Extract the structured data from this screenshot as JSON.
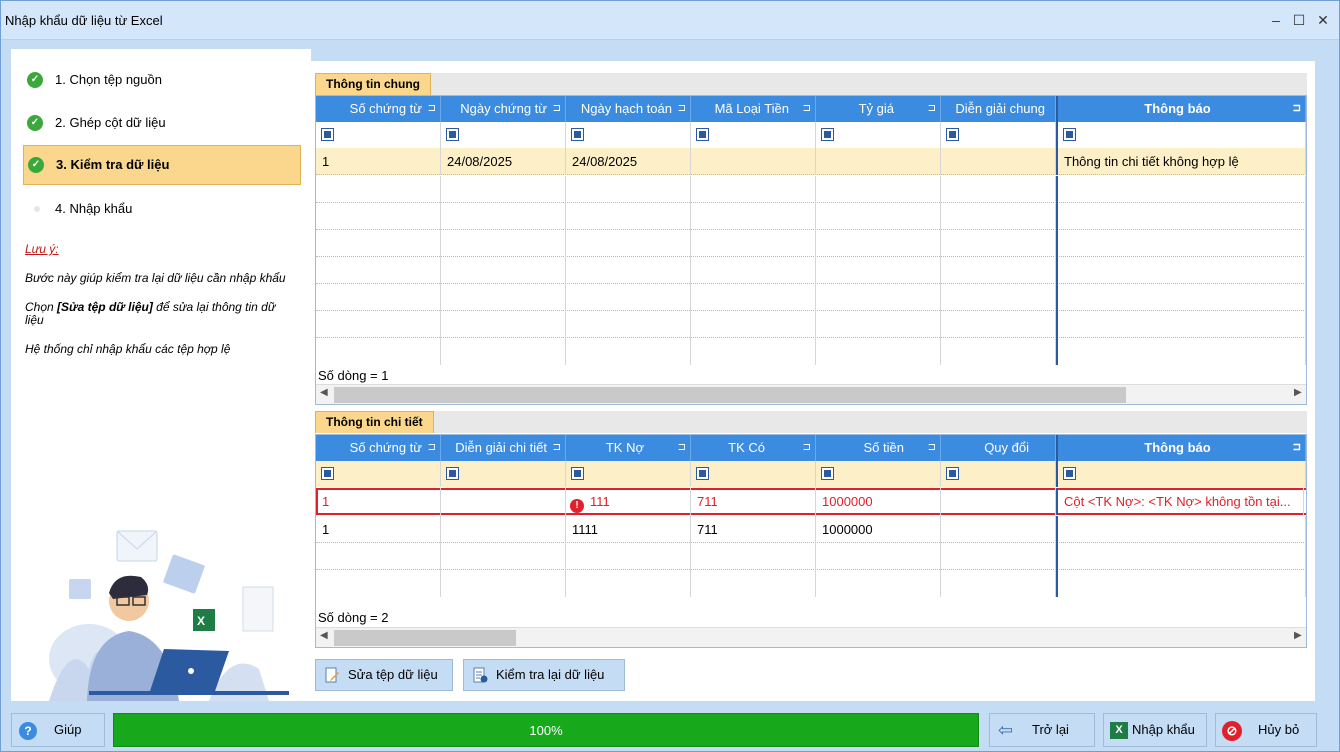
{
  "window": {
    "title": "Nhập khẩu dữ liệu từ Excel",
    "minimize": "–",
    "maximize": "☐",
    "close": "✕"
  },
  "steps": [
    {
      "label": "1. Chọn tệp nguồn",
      "state": "done"
    },
    {
      "label": "2. Ghép cột dữ liệu",
      "state": "done"
    },
    {
      "label": "3. Kiểm tra dữ liệu",
      "state": "active"
    },
    {
      "label": "4. Nhập khẩu",
      "state": "pending"
    }
  ],
  "notes": {
    "title": "Lưu ý:",
    "line1": "Bước này giúp kiểm tra lại dữ liệu cần nhập khẩu",
    "line2_prefix": "Chọn ",
    "line2_bold": "[Sửa tệp dữ liệu]",
    "line2_suffix": " để sửa lại thông tin dữ liệu",
    "line3": "Hệ thống chỉ nhập khẩu các tệp hợp lệ"
  },
  "general": {
    "tab": "Thông tin chung",
    "columns": [
      "Số chứng từ",
      "Ngày chứng từ",
      "Ngày hạch toán",
      "Mã Loại Tiền",
      "Tỷ giá",
      "Diễn giải chung",
      "Thông báo"
    ],
    "rows": [
      [
        "1",
        "24/08/2025",
        "24/08/2025",
        "",
        "",
        "",
        "Thông tin chi tiết không hợp lệ"
      ]
    ],
    "row_count": "Số dòng = 1"
  },
  "detail": {
    "tab": "Thông tin chi tiết",
    "columns": [
      "Số chứng từ",
      "Diễn giải chi tiết",
      "TK Nợ",
      "TK Có",
      "Số tiền",
      "Quy đổi",
      "Thông báo"
    ],
    "rows": [
      [
        "1",
        "",
        "111",
        "711",
        "1000000",
        "",
        "Cột <TK Nợ>: <TK Nợ> không tồn tại..."
      ],
      [
        "1",
        "",
        "1111",
        "711",
        "1000000",
        "",
        ""
      ]
    ],
    "row_count": "Số dòng = 2"
  },
  "actions": {
    "edit": "Sửa tệp dữ liệu",
    "recheck": "Kiểm tra lại dữ liệu"
  },
  "footer": {
    "help": "Giúp",
    "progress": "100%",
    "progress_value": 1.0,
    "back": "Trở lại",
    "import": "Nhập khẩu",
    "cancel": "Hủy bỏ"
  },
  "colors": {
    "accent": "#3b8be0",
    "highlight": "#fbd68d",
    "error": "#e0202a",
    "success": "#17a81c"
  }
}
